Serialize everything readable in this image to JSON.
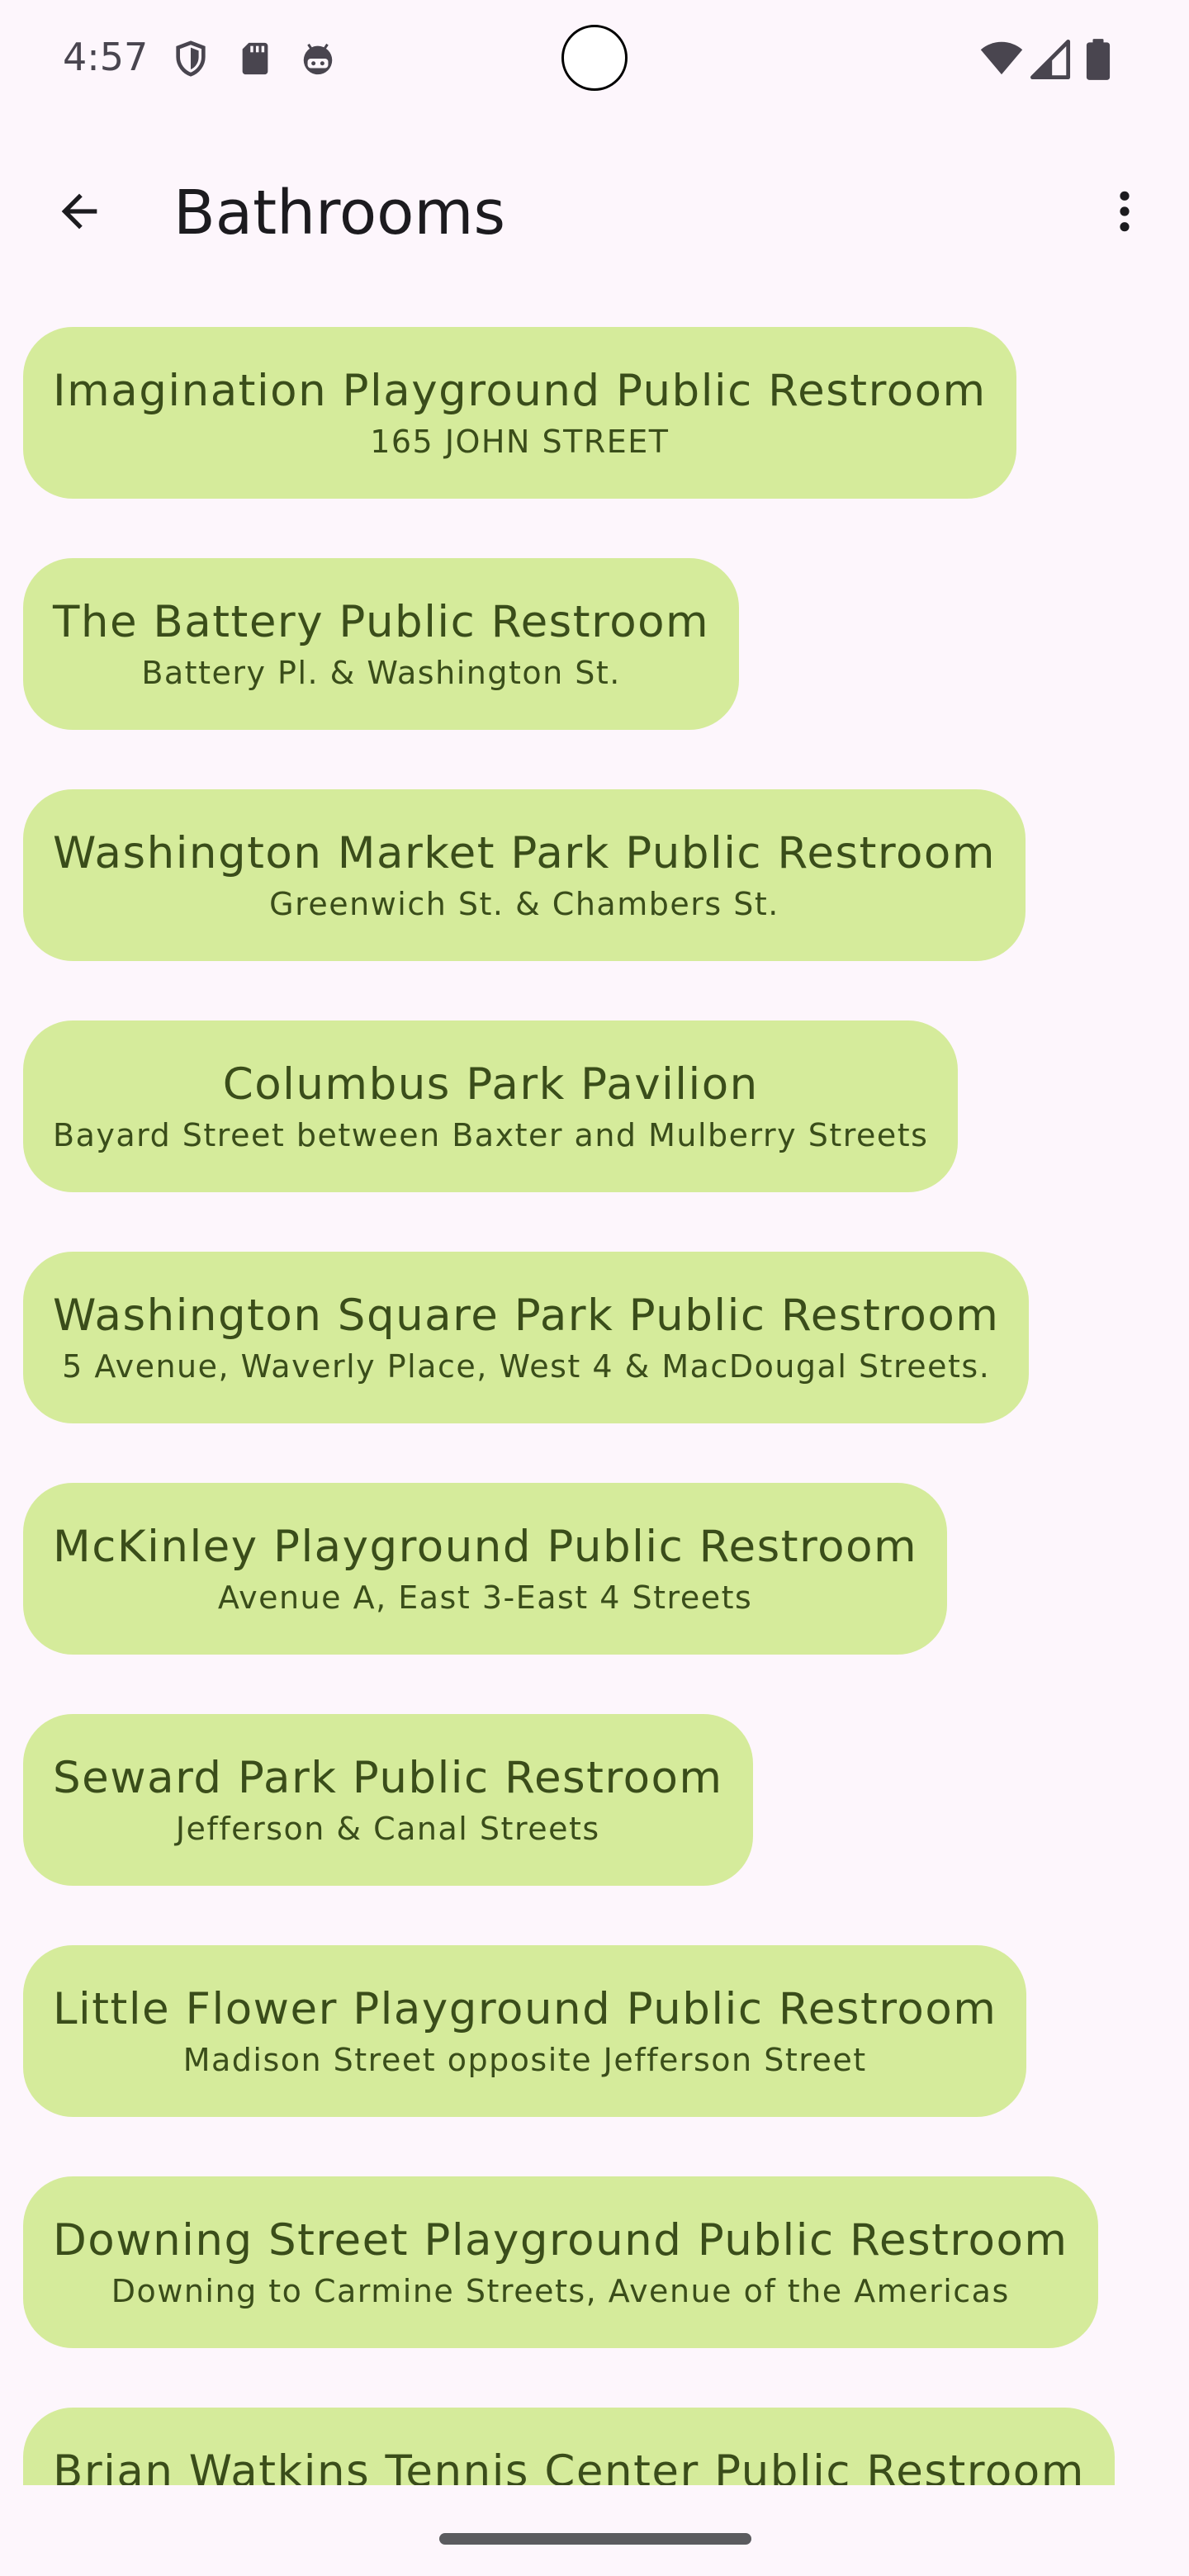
{
  "status_bar": {
    "time": "4:57",
    "left_icons": [
      "shield-icon",
      "sd-card-icon",
      "android-face-icon"
    ],
    "right_icons": [
      "wifi-icon",
      "signal-icon",
      "battery-icon"
    ]
  },
  "app_bar": {
    "title": "Bathrooms",
    "back_icon": "arrow-back-icon",
    "menu_icon": "more-vert-icon"
  },
  "colors": {
    "background": "#FDF6FC",
    "card": "#D5EB9B",
    "card_text": "#3A4D1A"
  },
  "restrooms": [
    {
      "name": "Imagination Playground Public Restroom",
      "address": "165 JOHN STREET"
    },
    {
      "name": "The Battery Public Restroom",
      "address": "Battery Pl. & Washington St."
    },
    {
      "name": "Washington Market Park Public Restroom",
      "address": "Greenwich St. & Chambers St."
    },
    {
      "name": "Columbus Park Pavilion",
      "address": "Bayard Street between Baxter and Mulberry Streets"
    },
    {
      "name": "Washington Square Park Public Restroom",
      "address": "5 Avenue, Waverly Place, West 4 & MacDougal Streets."
    },
    {
      "name": "McKinley Playground Public Restroom",
      "address": "Avenue A, East 3-East 4 Streets"
    },
    {
      "name": "Seward Park Public Restroom",
      "address": "Jefferson & Canal Streets"
    },
    {
      "name": "Little Flower Playground Public Restroom",
      "address": "Madison Street opposite Jefferson Street"
    },
    {
      "name": "Downing Street Playground Public Restroom",
      "address": "Downing to Carmine Streets, Avenue of the Americas"
    },
    {
      "name": "Brian Watkins Tennis Center Public Restroom",
      "address": ""
    }
  ]
}
